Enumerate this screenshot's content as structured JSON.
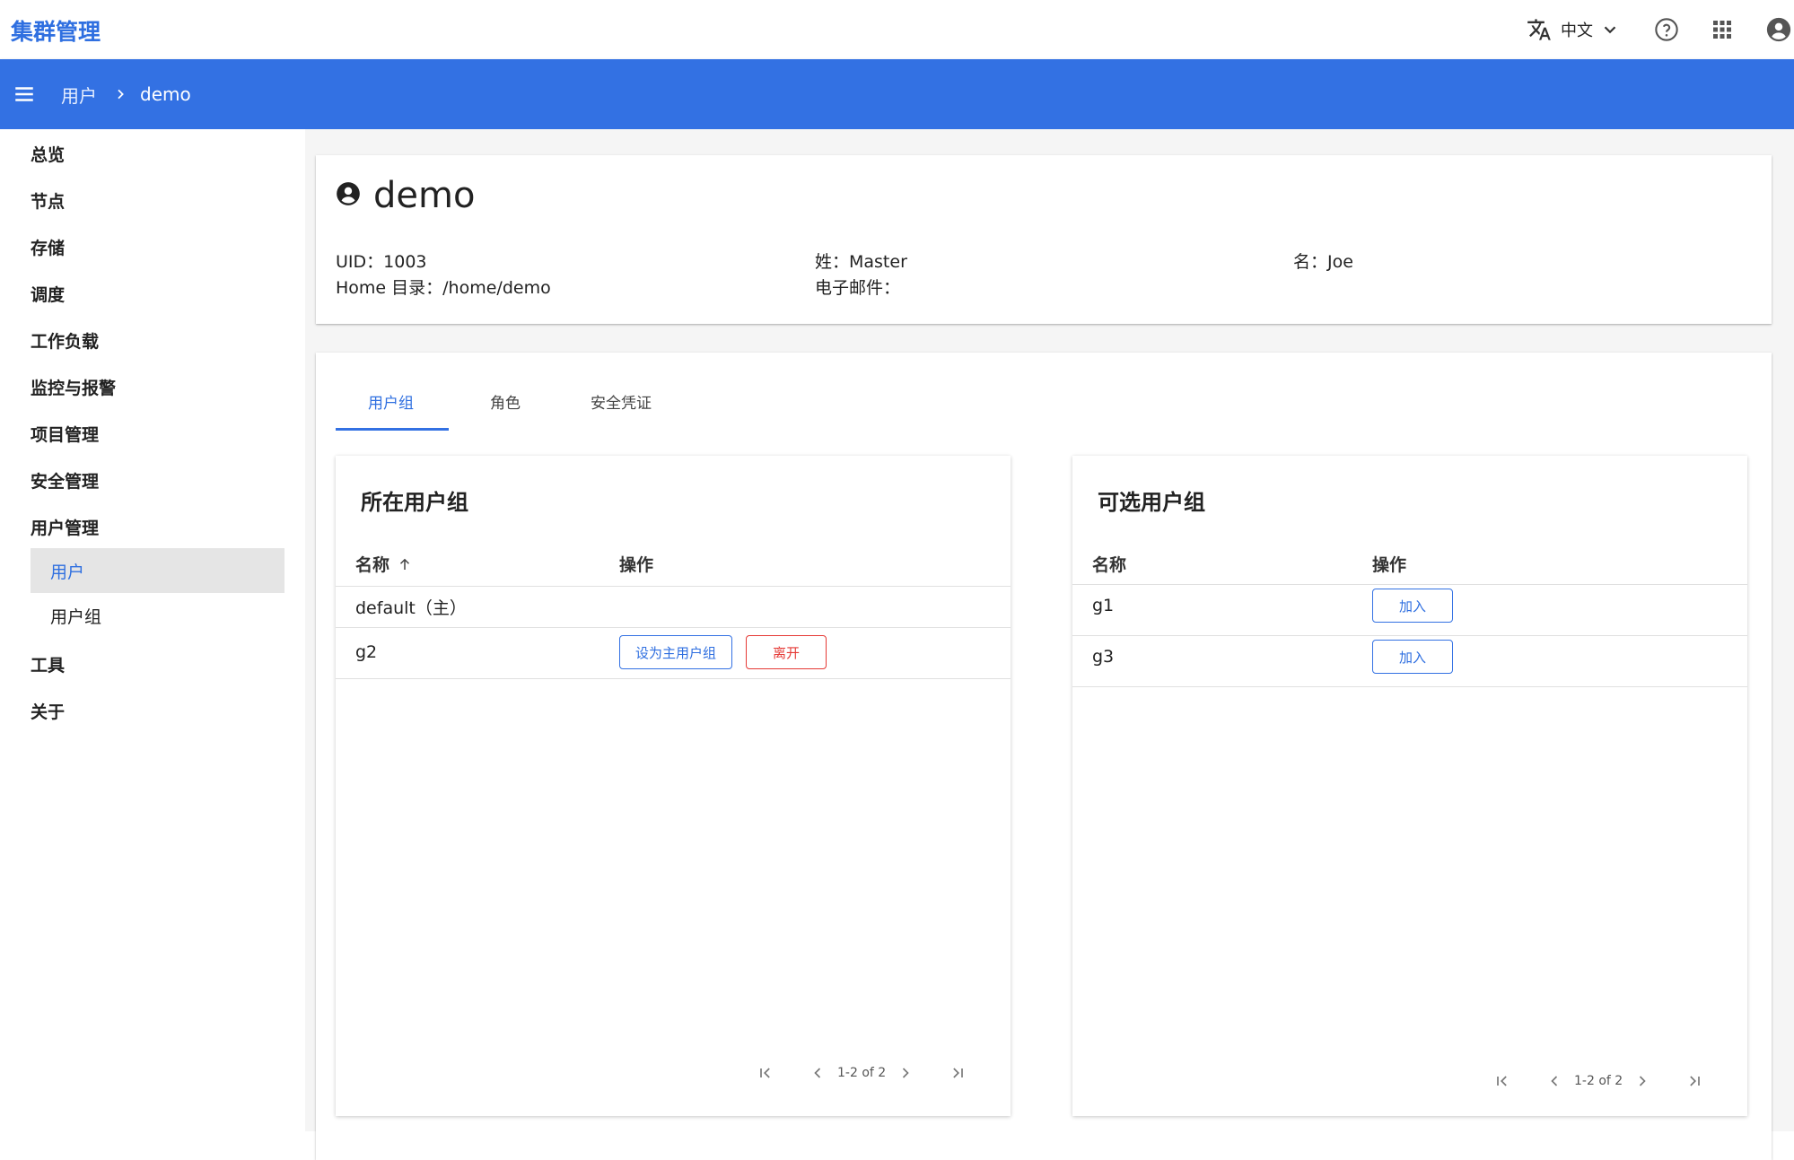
{
  "app": {
    "title": "集群管理"
  },
  "header": {
    "language_label": "中文",
    "icons": [
      "translate-icon",
      "chevron-down-icon",
      "help-icon",
      "apps-icon",
      "account-icon"
    ]
  },
  "breadcrumb": {
    "parent": "用户",
    "current": "demo"
  },
  "sidebar": {
    "items": [
      {
        "label": "总览"
      },
      {
        "label": "节点"
      },
      {
        "label": "存储"
      },
      {
        "label": "调度"
      },
      {
        "label": "工作负载"
      },
      {
        "label": "监控与报警"
      },
      {
        "label": "项目管理"
      },
      {
        "label": "安全管理"
      },
      {
        "label": "用户管理"
      },
      {
        "label": "用户",
        "active": true
      },
      {
        "label": "用户组"
      },
      {
        "label": "工具"
      },
      {
        "label": "关于"
      }
    ]
  },
  "user": {
    "name": "demo",
    "uid": "UID：1003",
    "home": "Home 目录：/home/demo",
    "surname": "姓：Master",
    "email": "电子邮件：",
    "given_name": "名：Joe"
  },
  "tabs": [
    {
      "label": "用户组",
      "active": true
    },
    {
      "label": "角色"
    },
    {
      "label": "安全凭证"
    }
  ],
  "member_groups": {
    "title": "所在用户组",
    "columns": [
      "名称",
      "操作"
    ],
    "rows": [
      {
        "name": "default（主）",
        "actions": []
      },
      {
        "name": "g2",
        "actions": [
          "设为主用户组",
          "离开"
        ]
      }
    ],
    "pagination": "1-2 of 2"
  },
  "available_groups": {
    "title": "可选用户组",
    "columns": [
      "名称",
      "操作"
    ],
    "rows": [
      {
        "name": "g1",
        "action": "加入"
      },
      {
        "name": "g3",
        "action": "加入"
      }
    ],
    "pagination": "1-2 of 2"
  },
  "colors": {
    "primary": "#3371e3",
    "accent_text": "#2f6fe0",
    "danger": "#e53935"
  }
}
